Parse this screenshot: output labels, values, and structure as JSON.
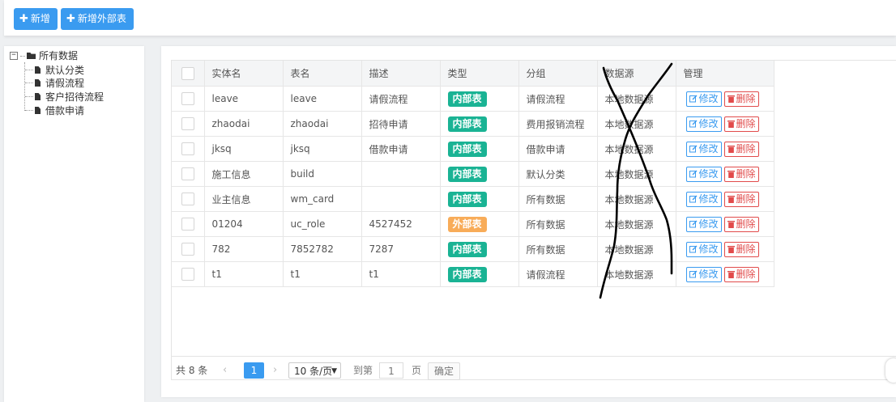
{
  "toolbar": {
    "add_label": "新增",
    "add_external_label": "新增外部表",
    "plus_icon": "plus-icon"
  },
  "tree": {
    "root_label": "所有数据",
    "toggle_glyph": "−",
    "children": [
      "默认分类",
      "请假流程",
      "客户招待流程",
      "借款申请"
    ]
  },
  "table": {
    "headers": [
      "实体名",
      "表名",
      "描述",
      "类型",
      "分组",
      "数据源",
      "管理"
    ],
    "rows": [
      {
        "entity": "leave",
        "table": "leave",
        "desc": "请假流程",
        "type": "内部表",
        "type_kind": "inner",
        "group": "请假流程",
        "source": "本地数据源"
      },
      {
        "entity": "zhaodai",
        "table": "zhaodai",
        "desc": "招待申请",
        "type": "内部表",
        "type_kind": "inner",
        "group": "费用报销流程",
        "source": "本地数据源"
      },
      {
        "entity": "jksq",
        "table": "jksq",
        "desc": "借款申请",
        "type": "内部表",
        "type_kind": "inner",
        "group": "借款申请",
        "source": "本地数据源"
      },
      {
        "entity": "施工信息",
        "table": "build",
        "desc": "",
        "type": "内部表",
        "type_kind": "inner",
        "group": "默认分类",
        "source": "本地数据源"
      },
      {
        "entity": "业主信息",
        "table": "wm_card",
        "desc": "",
        "type": "内部表",
        "type_kind": "inner",
        "group": "所有数据",
        "source": "本地数据源"
      },
      {
        "entity": "01204",
        "table": "uc_role",
        "desc": "4527452",
        "type": "外部表",
        "type_kind": "outer",
        "group": "所有数据",
        "source": "本地数据源"
      },
      {
        "entity": "782",
        "table": "7852782",
        "desc": "7287",
        "type": "内部表",
        "type_kind": "inner",
        "group": "所有数据",
        "source": "本地数据源"
      },
      {
        "entity": "t1",
        "table": "t1",
        "desc": "t1",
        "type": "内部表",
        "type_kind": "inner",
        "group": "请假流程",
        "source": "本地数据源"
      }
    ],
    "edit_label": "修改",
    "delete_label": "删除",
    "colors": {
      "inner": "#1ab394",
      "outer": "#f8ac59",
      "edit": "#3a9bf0",
      "delete": "#e14b4b"
    }
  },
  "pager": {
    "total_text": "共 8 条",
    "prev_glyph": "‹",
    "next_glyph": "›",
    "current_page": "1",
    "page_size": "10 条/页",
    "goto_label": "到第",
    "goto_value": "1",
    "page_unit": "页",
    "confirm_label": "确定"
  },
  "colors": {
    "accent": "#3a9bf0"
  }
}
